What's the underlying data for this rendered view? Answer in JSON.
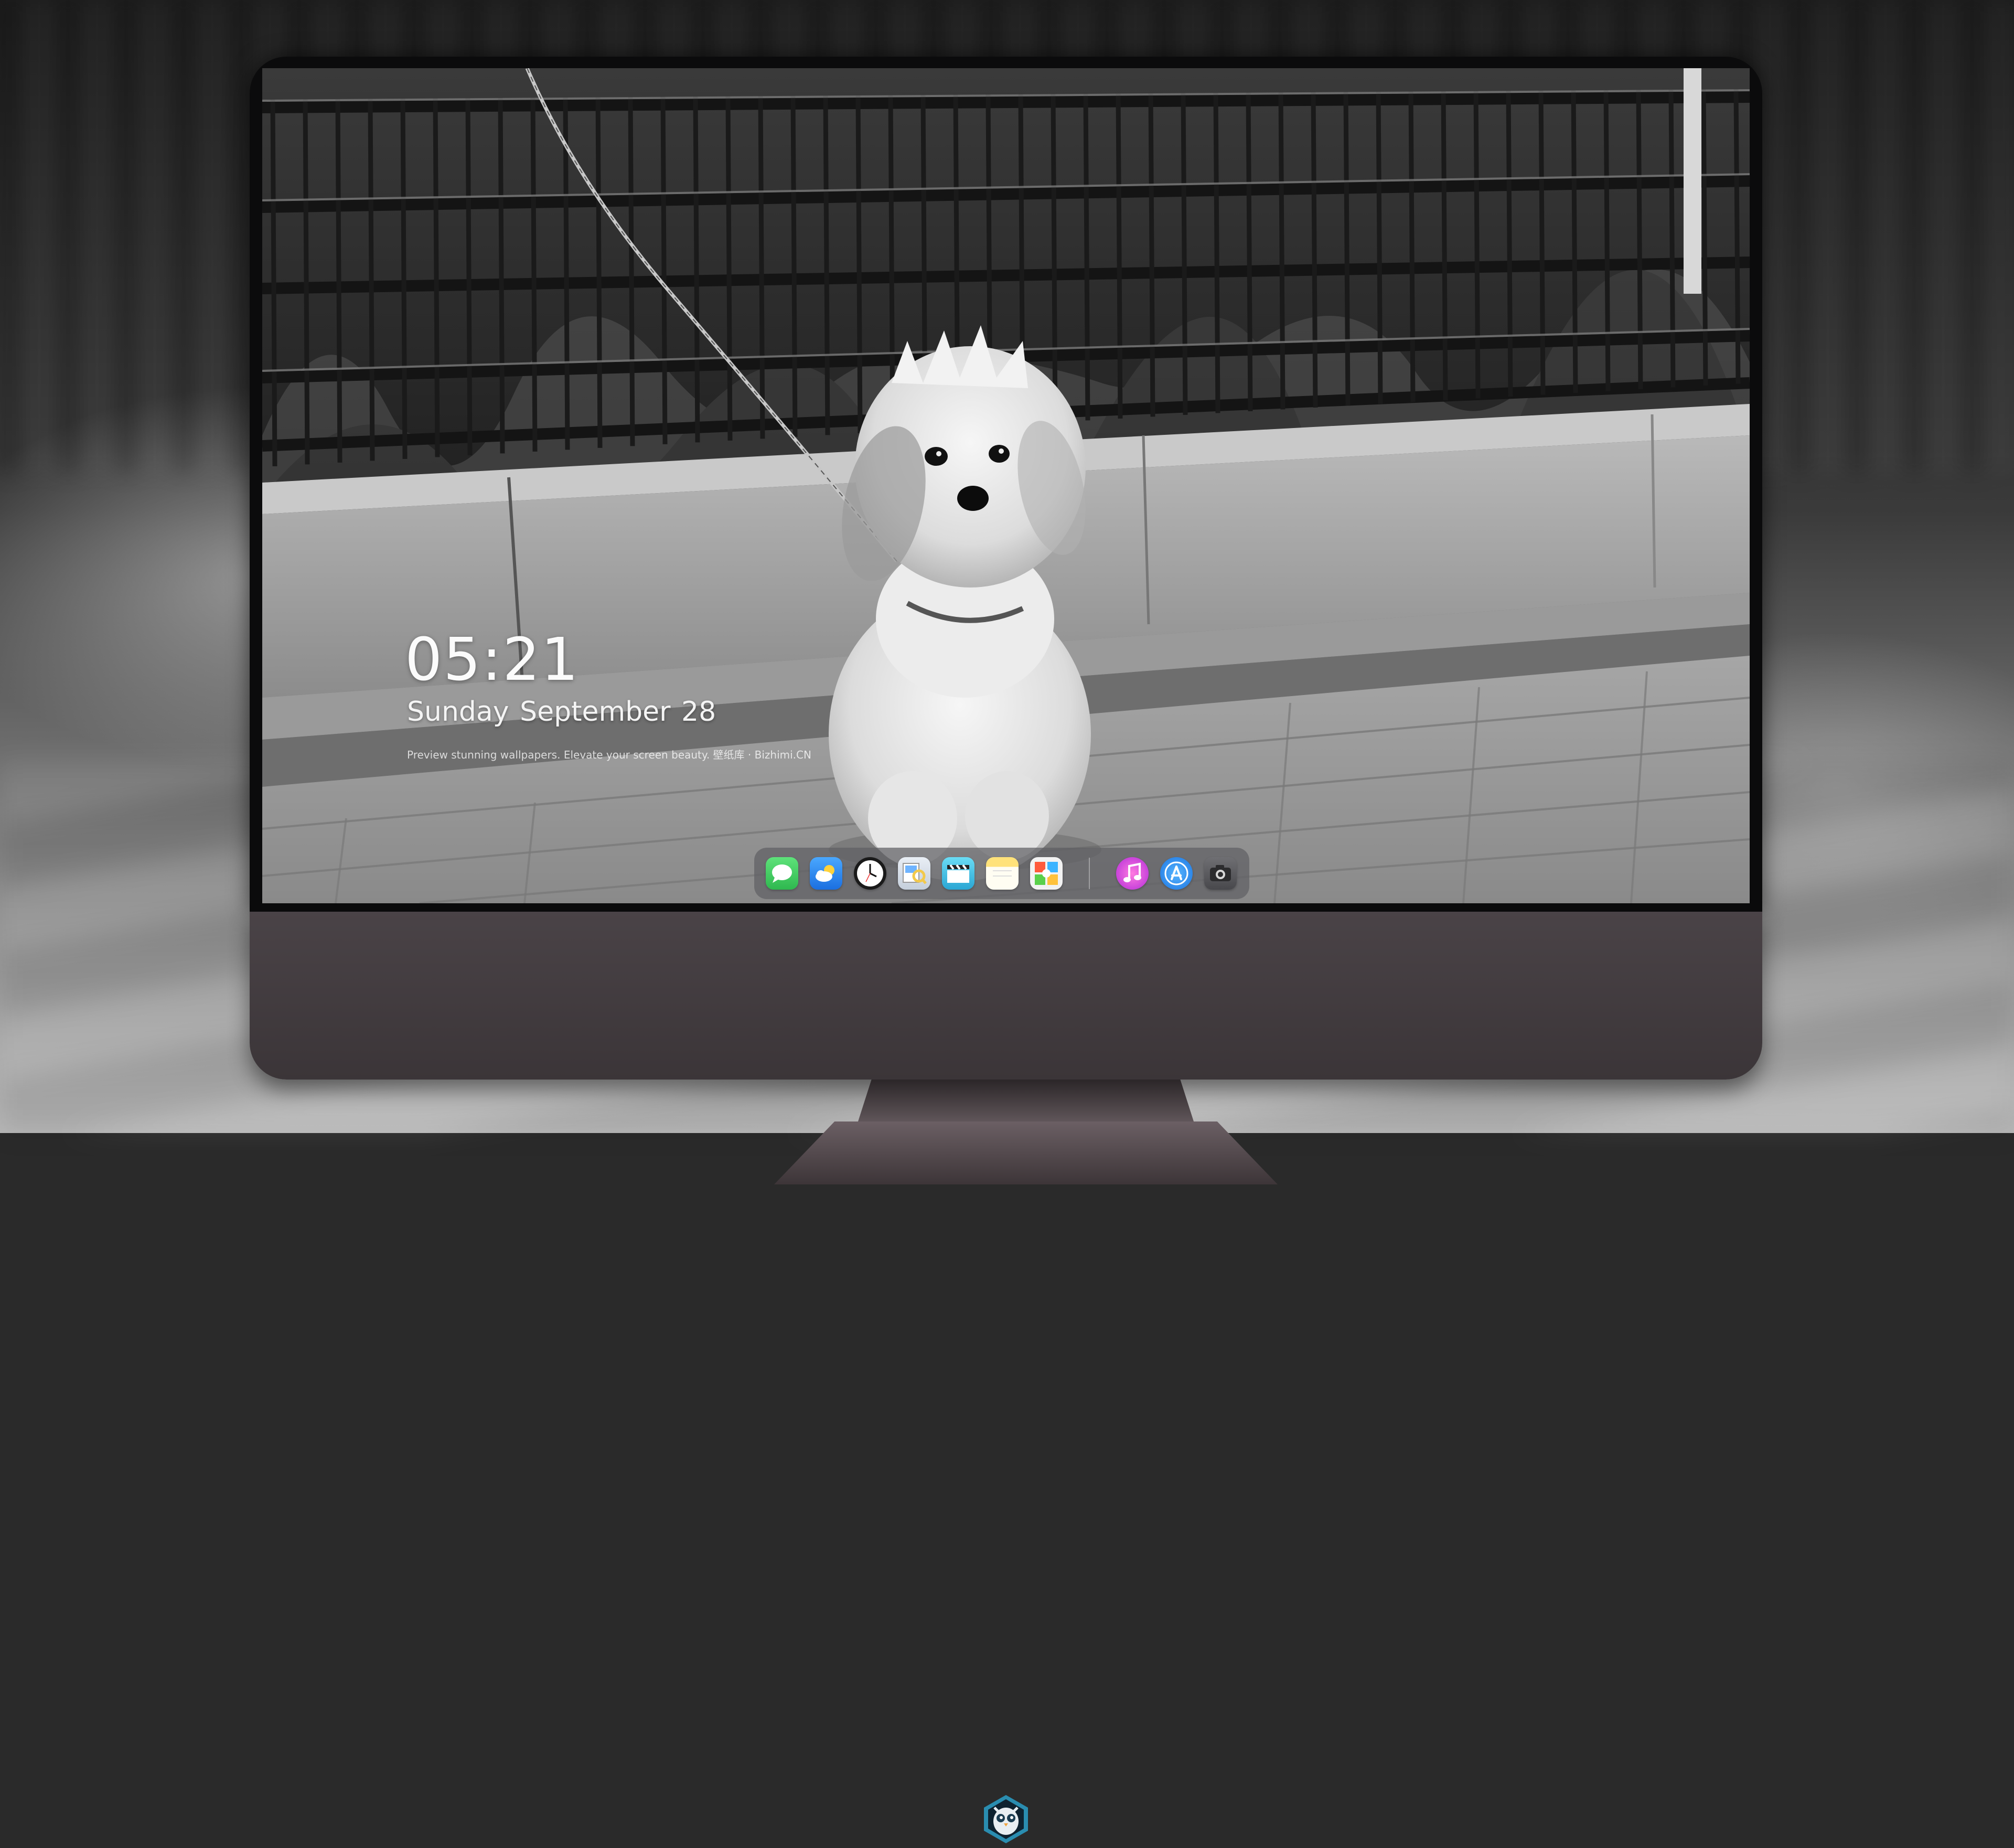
{
  "lockscreen": {
    "time": "05:21",
    "date": "Sunday September  28",
    "caption": "Preview stunning wallpapers. Elevate your screen beauty. 壁纸库 · Bizhimi.CN"
  },
  "dock": {
    "apps": [
      {
        "icon": "messages-icon",
        "color": "#35c759"
      },
      {
        "icon": "weather-icon",
        "color": "#2f8ef5"
      },
      {
        "icon": "clock-icon",
        "color": "#ffffff"
      },
      {
        "icon": "preview-icon",
        "color": "#f2c94c"
      },
      {
        "icon": "clapper-icon",
        "color": "#3ac6e8"
      },
      {
        "icon": "notes-icon",
        "color": "#fdd34a"
      },
      {
        "icon": "photo-booth-icon",
        "color": "#e85b3a"
      },
      {
        "icon": "itunes-icon",
        "color": "#e44bd9"
      },
      {
        "icon": "app-store-icon",
        "color": "#1e90ff"
      },
      {
        "icon": "camera-icon",
        "color": "#5c5c60"
      }
    ]
  },
  "monitor": {
    "badge_icon": "owl-mascot-icon",
    "bezel_color": "#0b0b0c",
    "chin_color": "#443d40"
  }
}
